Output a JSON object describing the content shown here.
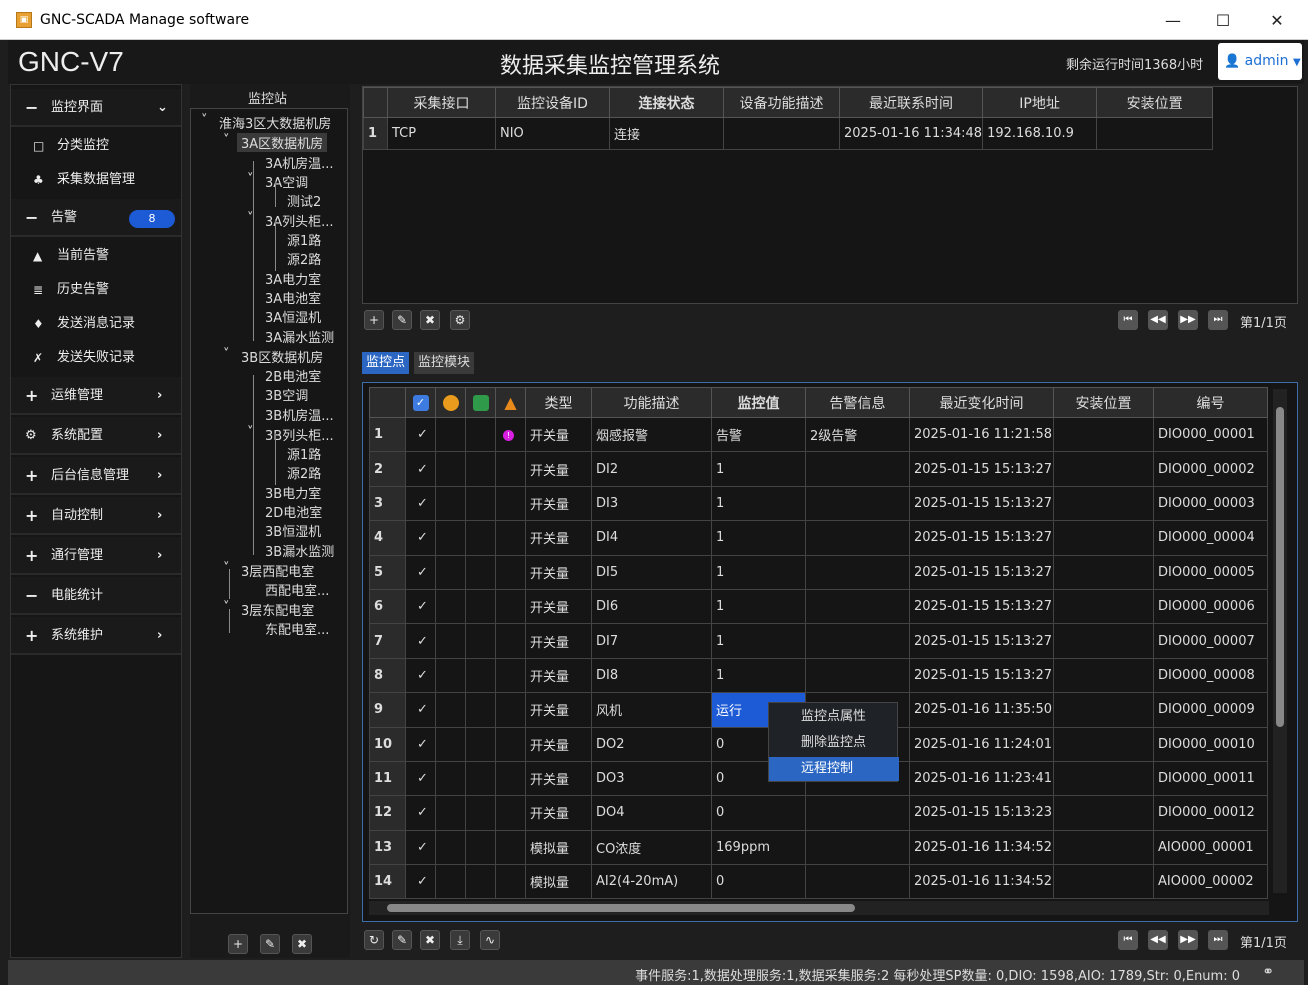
{
  "window": {
    "title": "GNC-SCADA Manage software",
    "min": "—",
    "max": "☐",
    "close": "✕"
  },
  "header": {
    "brand": "GNC-V7",
    "system_title": "数据采集监控管理系统",
    "runtime": "剩余运行时间1368小时",
    "user": "admin"
  },
  "sidebar": {
    "monitor": {
      "label": "监控界面",
      "sign": "−",
      "arrow": "⌄"
    },
    "monitor_items": [
      {
        "label": "分类监控",
        "icon": "□"
      },
      {
        "label": "采集数据管理",
        "icon": "♣"
      }
    ],
    "alarm": {
      "label": "告警",
      "sign": "−",
      "badge": "8"
    },
    "alarm_items": [
      {
        "label": "当前告警",
        "icon": "▲"
      },
      {
        "label": "历史告警",
        "icon": "≣"
      },
      {
        "label": "发送消息记录",
        "icon": "♦"
      },
      {
        "label": "发送失败记录",
        "icon": "✗"
      }
    ],
    "groups": [
      {
        "label": "运维管理",
        "sign": "+",
        "arrow": "›"
      },
      {
        "label": "系统配置",
        "sign": "⚙",
        "arrow": "›"
      },
      {
        "label": "后台信息管理",
        "sign": "+",
        "arrow": "›"
      },
      {
        "label": "自动控制",
        "sign": "+",
        "arrow": "›"
      },
      {
        "label": "通行管理",
        "sign": "+",
        "arrow": "›"
      },
      {
        "label": "电能统计",
        "sign": "−",
        "arrow": ""
      },
      {
        "label": "系统维护",
        "sign": "+",
        "arrow": "›"
      }
    ]
  },
  "tree": {
    "title": "监控站",
    "nodes": [
      "淮海3区大数据机房",
      "3A区数据机房",
      "3A机房温...",
      "3A空调",
      "测试2",
      "3A列头柜...",
      "源1路",
      "源2路",
      "3A电力室",
      "3A电池室",
      "3A恒湿机",
      "3A漏水监测",
      "3B区数据机房",
      "2B电池室",
      "3B空调",
      "3B机房温...",
      "3B列头柜...",
      "源1路",
      "源2路",
      "3B电力室",
      "2D电池室",
      "3B恒湿机",
      "3B漏水监测",
      "3层西配电室",
      "西配电室...",
      "3层东配电室",
      "东配电室..."
    ]
  },
  "top_table": {
    "headers": [
      "采集接口",
      "监控设备ID",
      "连接状态",
      "设备功能描述",
      "最近联系时间",
      "IP地址",
      "安装位置"
    ],
    "rows": [
      {
        "num": "1",
        "cells": [
          "TCP",
          "NIO",
          "连接",
          "",
          "2025-01-16 11:34:48",
          "192.168.10.9",
          ""
        ]
      }
    ],
    "pager": "第1/1页"
  },
  "tabs": [
    "监控点",
    "监控模块"
  ],
  "bottom_table": {
    "headers": [
      "类型",
      "功能描述",
      "监控值",
      "告警信息",
      "最近变化时间",
      "安装位置",
      "编号"
    ],
    "rows": [
      {
        "num": "1",
        "alarm": true,
        "cells": [
          "开关量",
          "烟感报警",
          "告警",
          "2级告警",
          "2025-01-16 11:21:58",
          "",
          "DIO000_00001"
        ]
      },
      {
        "num": "2",
        "cells": [
          "开关量",
          "DI2",
          "1",
          "",
          "2025-01-15 15:13:27",
          "",
          "DIO000_00002"
        ]
      },
      {
        "num": "3",
        "cells": [
          "开关量",
          "DI3",
          "1",
          "",
          "2025-01-15 15:13:27",
          "",
          "DIO000_00003"
        ]
      },
      {
        "num": "4",
        "cells": [
          "开关量",
          "DI4",
          "1",
          "",
          "2025-01-15 15:13:27",
          "",
          "DIO000_00004"
        ]
      },
      {
        "num": "5",
        "cells": [
          "开关量",
          "DI5",
          "1",
          "",
          "2025-01-15 15:13:27",
          "",
          "DIO000_00005"
        ]
      },
      {
        "num": "6",
        "cells": [
          "开关量",
          "DI6",
          "1",
          "",
          "2025-01-15 15:13:27",
          "",
          "DIO000_00006"
        ]
      },
      {
        "num": "7",
        "cells": [
          "开关量",
          "DI7",
          "1",
          "",
          "2025-01-15 15:13:27",
          "",
          "DIO000_00007"
        ]
      },
      {
        "num": "8",
        "cells": [
          "开关量",
          "DI8",
          "1",
          "",
          "2025-01-15 15:13:27",
          "",
          "DIO000_00008"
        ]
      },
      {
        "num": "9",
        "selected": true,
        "cells": [
          "开关量",
          "风机",
          "运行",
          "",
          "2025-01-16 11:35:50",
          "",
          "DIO000_00009"
        ]
      },
      {
        "num": "10",
        "cells": [
          "开关量",
          "DO2",
          "0",
          "",
          "2025-01-16 11:24:01",
          "",
          "DIO000_00010"
        ]
      },
      {
        "num": "11",
        "cells": [
          "开关量",
          "DO3",
          "0",
          "",
          "2025-01-16 11:23:41",
          "",
          "DIO000_00011"
        ]
      },
      {
        "num": "12",
        "cells": [
          "开关量",
          "DO4",
          "0",
          "",
          "2025-01-15 15:13:23",
          "",
          "DIO000_00012"
        ]
      },
      {
        "num": "13",
        "cells": [
          "模拟量",
          "CO浓度",
          "169ppm",
          "",
          "2025-01-16 11:34:52",
          "",
          "AIO000_00001"
        ]
      },
      {
        "num": "14",
        "cells": [
          "模拟量",
          "AI2(4-20mA)",
          "0",
          "",
          "2025-01-16 11:34:52",
          "",
          "AIO000_00002"
        ]
      }
    ],
    "pager": "第1/1页"
  },
  "context_menu": [
    "监控点属性",
    "删除监控点",
    "远程控制"
  ],
  "status": "事件服务:1,数据处理服务:1,数据采集服务:2  每秒处理SP数量: 0,DIO: 1598,AIO: 1789,Str: 0,Enum: 0"
}
